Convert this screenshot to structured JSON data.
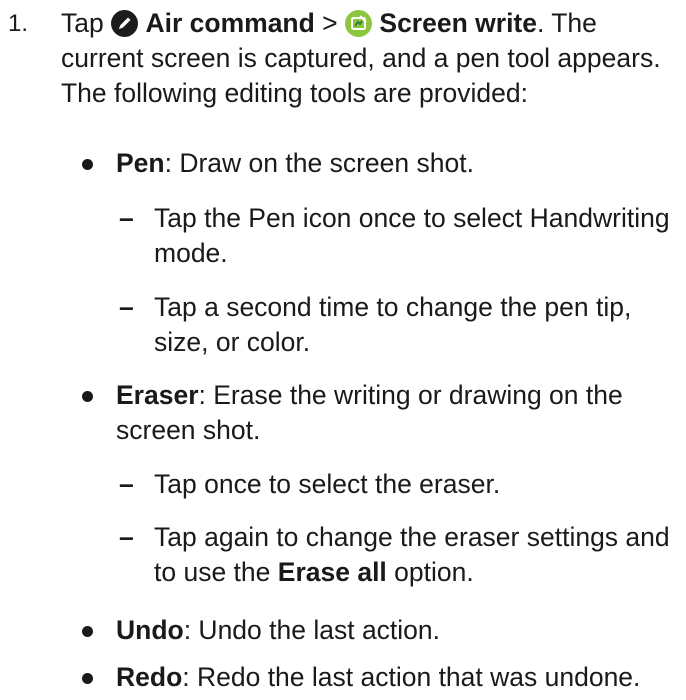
{
  "step": {
    "number": "1.",
    "prefix": "Tap ",
    "air_command": "Air command",
    "separator": " > ",
    "screen_write": "Screen write",
    "rest": ". The current screen is captured, and a pen tool appears. The following editing tools are provided:"
  },
  "icons": {
    "air_command": "air-command-icon",
    "screen_write": "screen-write-icon"
  },
  "tools": [
    {
      "name": "Pen",
      "desc": ": Draw on the screen shot.",
      "subitems": [
        "Tap the Pen icon once to select Handwriting mode.",
        "Tap a second time to change the pen tip, size, or color."
      ]
    },
    {
      "name": "Eraser",
      "desc": ": Erase the writing or drawing on the screen shot.",
      "subitems": [
        "Tap once to select the eraser.",
        {
          "before": "Tap again to change the eraser settings and to use the ",
          "bold": "Erase all",
          "after": " option."
        }
      ]
    },
    {
      "name": "Undo",
      "desc": ": Undo the last action."
    },
    {
      "name": "Redo",
      "desc": ": Redo the last action that was undone."
    }
  ],
  "dash_glyph": "–"
}
